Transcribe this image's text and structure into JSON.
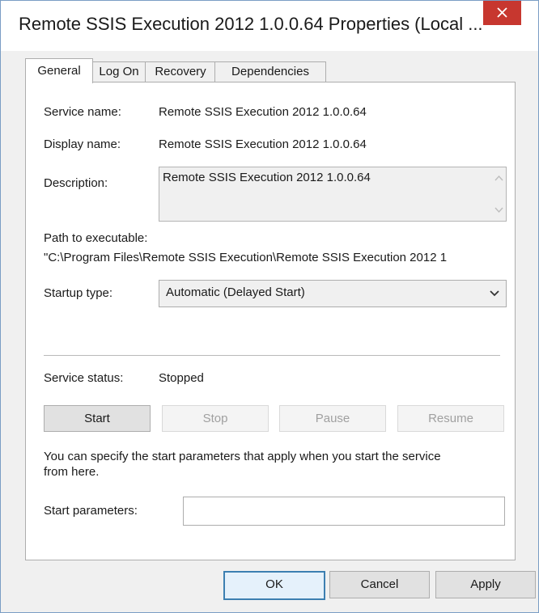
{
  "window": {
    "title": "Remote SSIS Execution 2012 1.0.0.64 Properties (Local ...",
    "close_icon": "close-icon"
  },
  "tabs": [
    {
      "label": "General",
      "active": true
    },
    {
      "label": "Log On",
      "active": false
    },
    {
      "label": "Recovery",
      "active": false
    },
    {
      "label": "Dependencies",
      "active": false
    }
  ],
  "general": {
    "service_name_label": "Service name:",
    "service_name_value": "Remote SSIS Execution 2012 1.0.0.64",
    "display_name_label": "Display name:",
    "display_name_value": "Remote SSIS Execution 2012 1.0.0.64",
    "description_label": "Description:",
    "description_value": "Remote SSIS Execution 2012 1.0.0.64",
    "path_label": "Path to executable:",
    "path_value": "\"C:\\Program Files\\Remote SSIS Execution\\Remote SSIS Execution 2012 1",
    "startup_type_label": "Startup type:",
    "startup_type_value": "Automatic (Delayed Start)",
    "service_status_label": "Service status:",
    "service_status_value": "Stopped",
    "buttons": {
      "start": "Start",
      "stop": "Stop",
      "pause": "Pause",
      "resume": "Resume"
    },
    "hint_line1": "You can specify the start parameters that apply when you start the service",
    "hint_line2": "from here.",
    "start_params_label": "Start parameters:",
    "start_params_value": ""
  },
  "dialog_buttons": {
    "ok": "OK",
    "cancel": "Cancel",
    "apply": "Apply"
  }
}
